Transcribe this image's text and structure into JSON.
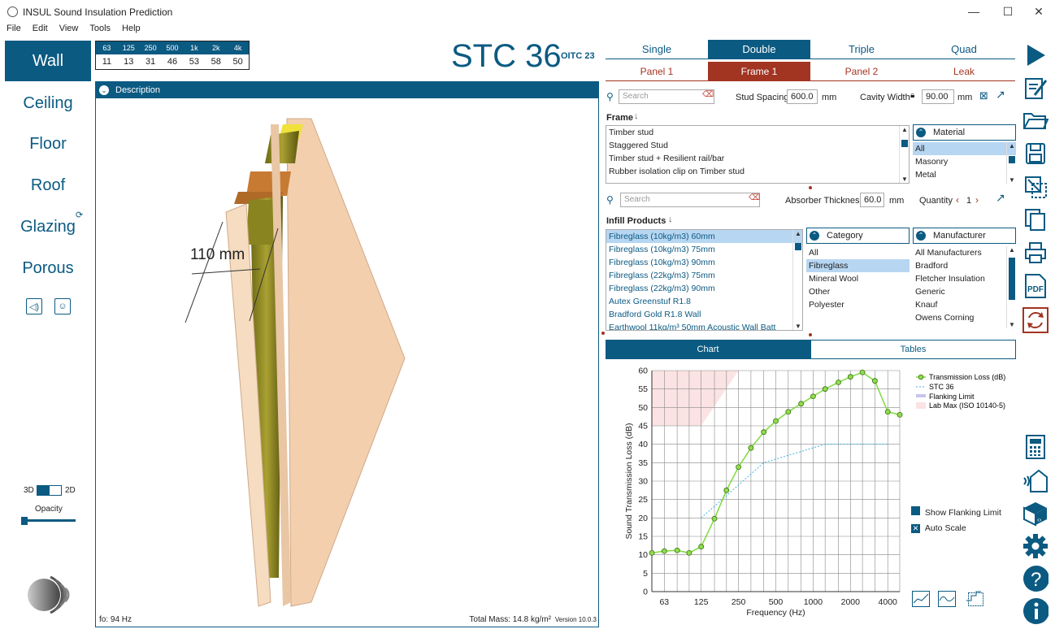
{
  "window": {
    "title": "INSUL Sound Insulation Prediction",
    "minimize": "—",
    "maximize": "☐",
    "close": "✕"
  },
  "menu": [
    "File",
    "Edit",
    "View",
    "Tools",
    "Help"
  ],
  "nav": {
    "active": "Wall",
    "items": [
      "Ceiling",
      "Floor",
      "Roof",
      "Glazing",
      "Porous"
    ],
    "toggle_3d": "3D",
    "toggle_2d": "2D",
    "opacity_label": "Opacity",
    "opacity_value": 0.02
  },
  "octave": {
    "bands": [
      "63",
      "125",
      "250",
      "500",
      "1k",
      "2k",
      "4k"
    ],
    "values": [
      "11",
      "13",
      "31",
      "46",
      "53",
      "58",
      "50"
    ]
  },
  "rating": {
    "stc": "STC 36",
    "oitc": "OITC 23"
  },
  "pane": {
    "header": "Description",
    "dimension": "110 mm",
    "fo": "fo: 94 Hz",
    "mass": "Total Mass: 14.8 kg/m²",
    "version": "Version 10.0.3"
  },
  "config": {
    "type_tabs": [
      "Single",
      "Double",
      "Triple",
      "Quad"
    ],
    "type_active": "Double",
    "element_tabs": [
      "Panel 1",
      "Frame 1",
      "Panel 2",
      "Leak"
    ],
    "element_active": "Frame 1",
    "frame_search_placeholder": "Search",
    "stud_spacing_label": "Stud Spacing",
    "stud_spacing_value": "600.0",
    "stud_spacing_unit": "mm",
    "cavity_width_label": "Cavity Width",
    "cavity_width_value": "90.00",
    "cavity_width_unit": "mm",
    "frame_label": "Frame",
    "frame_items": [
      "Timber stud",
      "Staggered Stud",
      "Timber stud + Resilient rail/bar",
      "Rubber isolation clip on Timber stud"
    ],
    "material_label": "Material",
    "material_items": [
      "All",
      "Masonry",
      "Metal"
    ],
    "material_selected": "All",
    "infill_search_placeholder": "Search",
    "absorber_label": "Absorber Thickness",
    "absorber_value": "60.0",
    "absorber_unit": "mm",
    "quantity_label": "Quantity",
    "quantity_value": "1",
    "infill_label": "Infill Products",
    "infill_items": [
      "Fibreglass (10kg/m3) 60mm",
      "Fibreglass (10kg/m3) 75mm",
      "Fibreglass (10kg/m3) 90mm",
      "Fibreglass (22kg/m3) 75mm",
      "Fibreglass (22kg/m3) 90mm",
      "Autex Greenstuf R1.8",
      "Bradford Gold R1.8 Wall",
      "Earthwool 11kg/m³ 50mm Acoustic Wall Batt"
    ],
    "infill_selected": "Fibreglass (10kg/m3) 60mm",
    "category_label": "Category",
    "category_items": [
      "All",
      "Fibreglass",
      "Mineral Wool",
      "Other",
      "Polyester"
    ],
    "category_selected": "Fibreglass",
    "manufacturer_label": "Manufacturer",
    "manufacturer_items": [
      "All Manufacturers",
      "Bradford",
      "Fletcher Insulation",
      "Generic",
      "Knauf",
      "Owens Corning"
    ]
  },
  "view_tabs": {
    "chart": "Chart",
    "tables": "Tables"
  },
  "options": {
    "show_flanking": "Show Flanking Limit",
    "auto_scale": "Auto Scale"
  },
  "chart_data": {
    "type": "line",
    "xlabel": "Frequency (Hz)",
    "ylabel": "Sound Transmission Loss (dB)",
    "xscale": "log",
    "xlim": [
      50,
      5000
    ],
    "ylim": [
      0,
      60
    ],
    "yticks": [
      0,
      5,
      10,
      15,
      20,
      25,
      30,
      35,
      40,
      45,
      50,
      55,
      60
    ],
    "xtick_labels": [
      "63",
      "125",
      "250",
      "500",
      "1000",
      "2000",
      "4000"
    ],
    "xtick_values": [
      63,
      125,
      250,
      500,
      1000,
      2000,
      4000
    ],
    "grid": true,
    "legend_position": "right",
    "series": [
      {
        "name": "Transmission Loss (dB)",
        "color": "#7ddb3c",
        "x": [
          50,
          63,
          80,
          100,
          125,
          160,
          200,
          250,
          315,
          400,
          500,
          630,
          800,
          1000,
          1250,
          1600,
          2000,
          2500,
          3150,
          4000,
          5000
        ],
        "y": [
          10.5,
          11,
          11.2,
          10.5,
          12.2,
          19.8,
          27.5,
          33.8,
          39,
          43.3,
          46.3,
          48.8,
          51,
          53,
          55,
          56.8,
          58.3,
          59.5,
          57.2,
          48.8,
          48
        ]
      },
      {
        "name": "STC 36",
        "color": "#3fb1e3",
        "x": [
          125,
          400,
          1250,
          4000
        ],
        "y": [
          20,
          35,
          40,
          40
        ]
      },
      {
        "name": "Flanking Limit",
        "color": "#c8c4f0",
        "x": [],
        "y": []
      },
      {
        "name": "Lab Max (ISO 10140-5)",
        "color": "#fbe3e3",
        "x": [
          50,
          125,
          250
        ],
        "y": [
          60,
          60,
          60
        ]
      }
    ]
  }
}
